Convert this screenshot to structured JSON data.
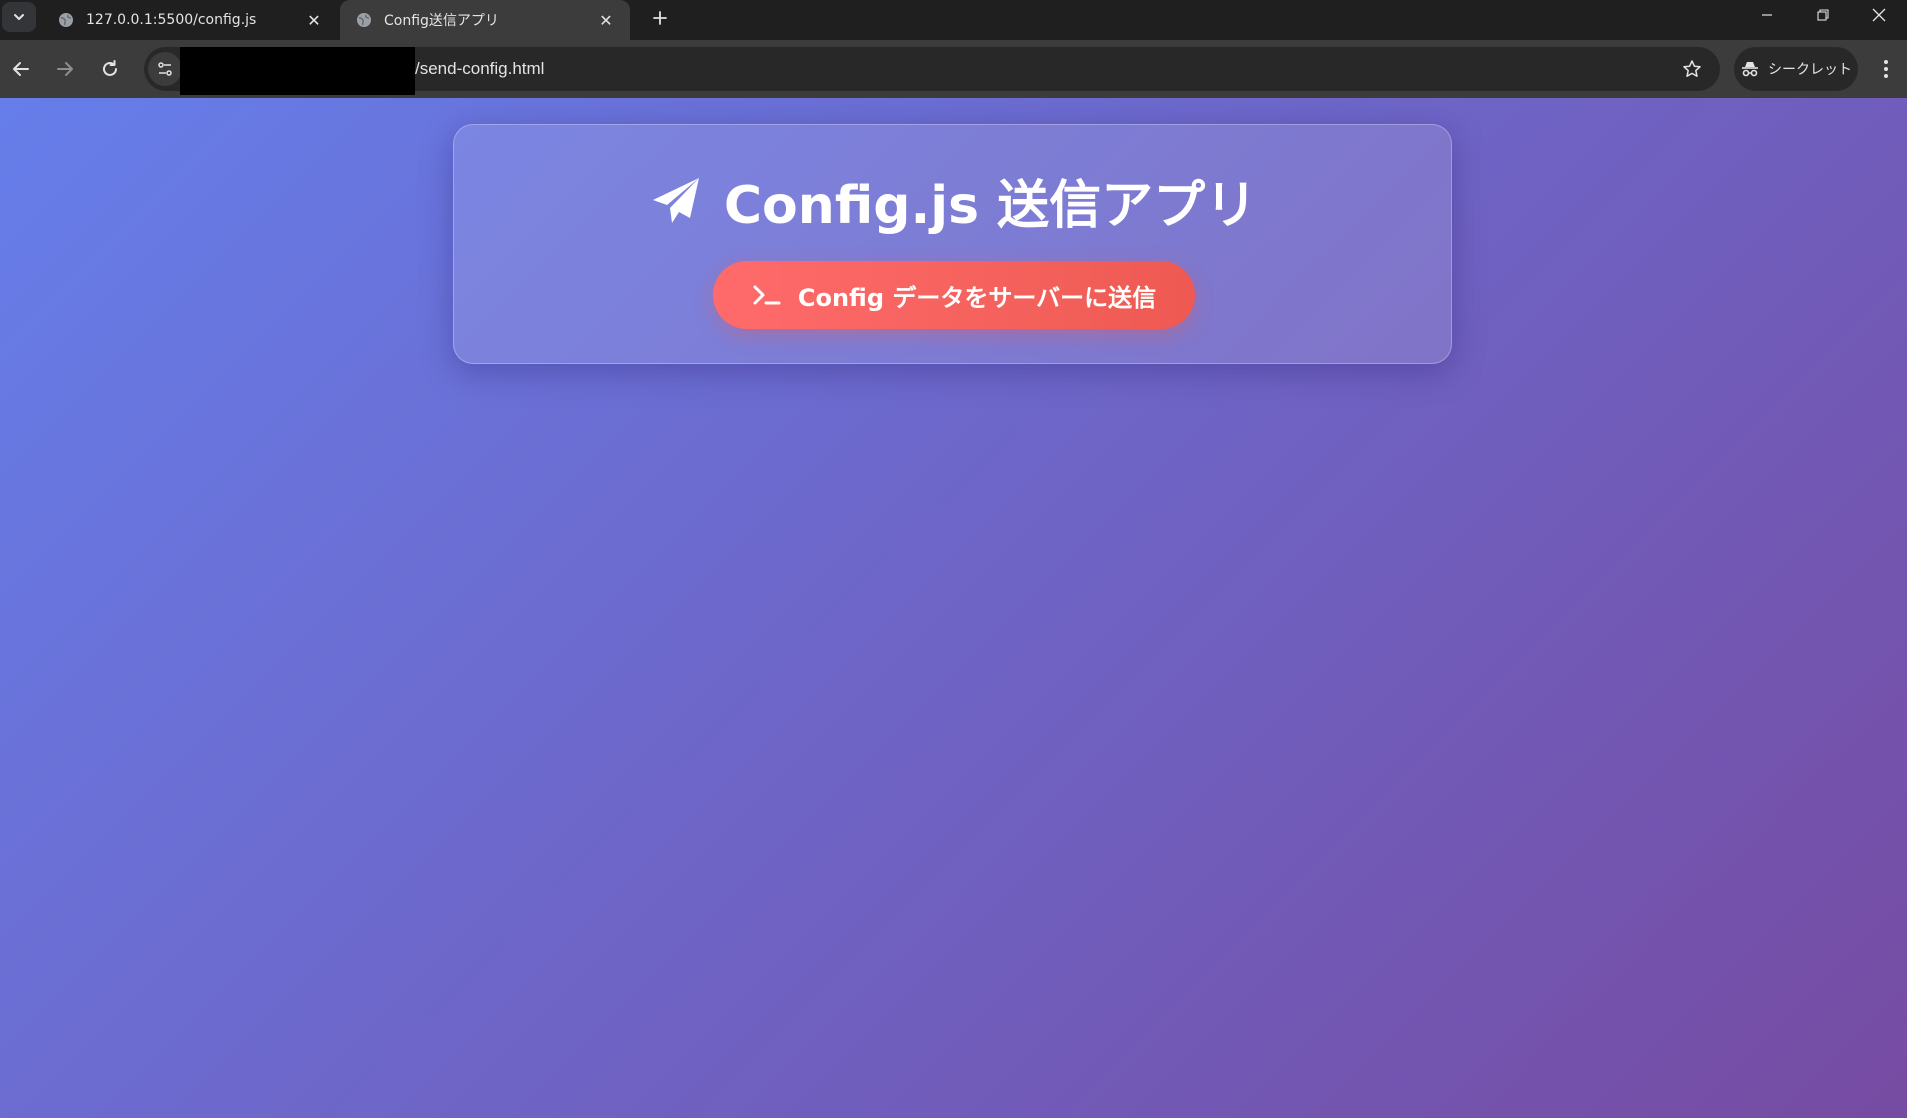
{
  "browser": {
    "tabs": [
      {
        "title": "127.0.0.1:5500/config.js",
        "active": false
      },
      {
        "title": "Config送信アプリ",
        "active": true
      }
    ],
    "address_bar": {
      "url_visible": "/send-config.html"
    },
    "incognito_label": "シークレット"
  },
  "page": {
    "title": "Config.js 送信アプリ",
    "send_button_label": "Config データをサーバーに送信"
  },
  "colors": {
    "background_gradient_start": "#667eea",
    "background_gradient_end": "#764ba2",
    "button_gradient_start": "#ff6b6b",
    "button_gradient_end": "#ee5a52"
  },
  "icons": {
    "title_icon": "paper-plane-icon",
    "button_icon": "terminal-icon"
  }
}
